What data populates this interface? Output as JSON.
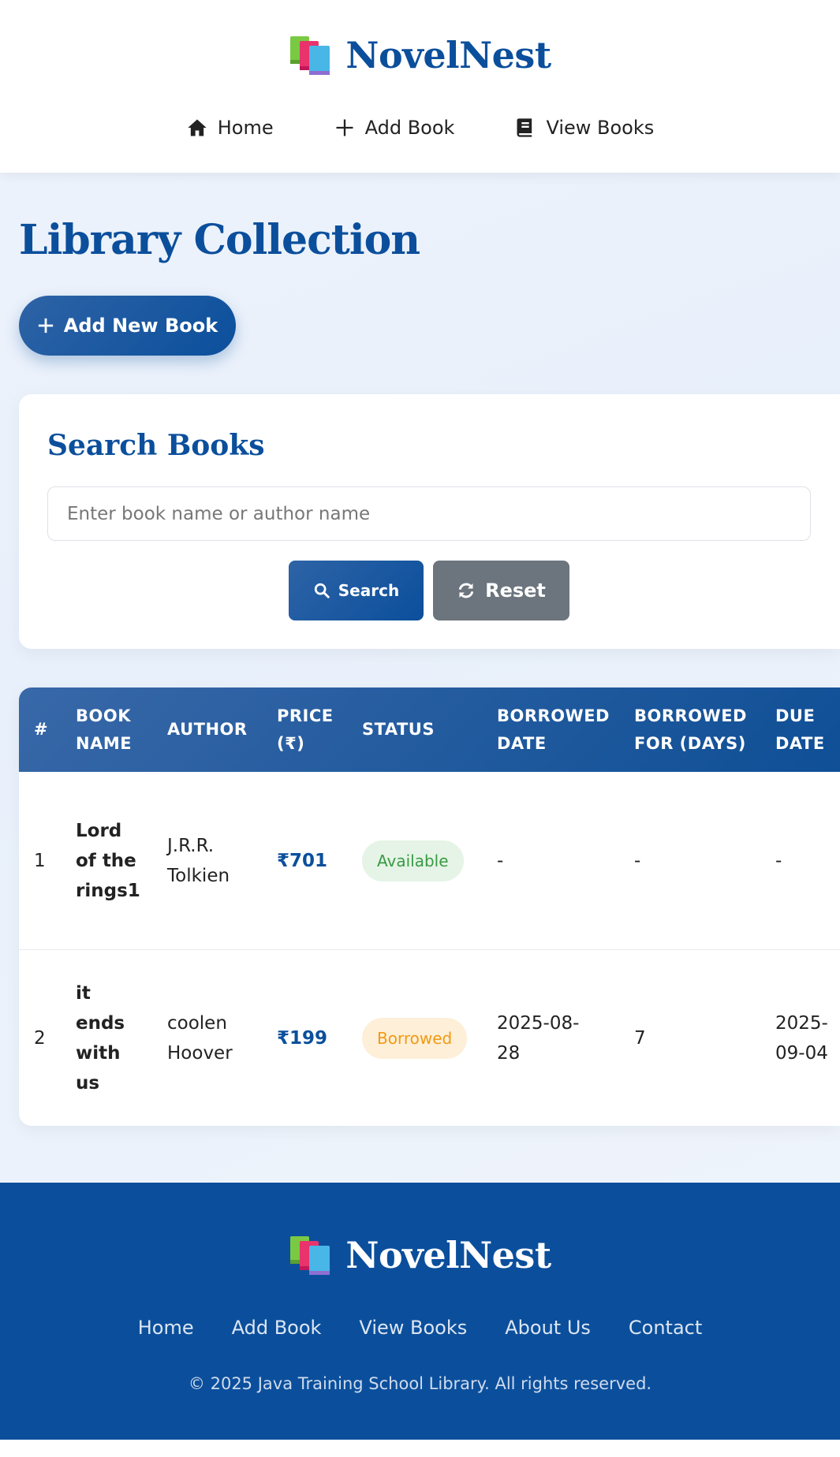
{
  "brand": {
    "name": "NovelNest"
  },
  "nav": [
    {
      "label": "Home",
      "icon": "home-icon"
    },
    {
      "label": "Add Book",
      "icon": "plus-icon"
    },
    {
      "label": "View Books",
      "icon": "book-icon"
    }
  ],
  "page": {
    "title": "Library Collection",
    "add_button_label": "Add New Book"
  },
  "search": {
    "title": "Search Books",
    "placeholder": "Enter book name or author name",
    "value": "",
    "search_button_label": "Search",
    "reset_button_label": "Reset"
  },
  "table": {
    "headers": {
      "index": "#",
      "book_name": [
        "BOOK",
        "NAME"
      ],
      "author": "AUTHOR",
      "price": [
        "PRICE",
        "(₹)"
      ],
      "status": "STATUS",
      "borrowed_date": [
        "BORROWED",
        "DATE"
      ],
      "borrowed_for": [
        "BORROWED",
        "FOR (DAYS)"
      ],
      "due_date": [
        "DUE",
        "DATE"
      ]
    },
    "rows": [
      {
        "index": "1",
        "book_name": [
          "Lord",
          "of the",
          "rings1"
        ],
        "author": [
          "J.R.R.",
          "Tolkien"
        ],
        "price": "₹701",
        "status": "Available",
        "borrowed_date": [
          "-"
        ],
        "borrowed_for": "-",
        "due_date": [
          "-"
        ]
      },
      {
        "index": "2",
        "book_name": [
          "it",
          "ends",
          "with",
          "us"
        ],
        "author": [
          "coolen",
          "Hoover"
        ],
        "price": "₹199",
        "status": "Borrowed",
        "borrowed_date": [
          "2025-08-",
          "28"
        ],
        "borrowed_for": "7",
        "due_date": [
          "2025-",
          "09-04"
        ]
      }
    ]
  },
  "footer": {
    "brand": "NovelNest",
    "links": [
      "Home",
      "Add Book",
      "View Books",
      "About Us",
      "Contact"
    ],
    "copyright": "© 2025 Java Training School Library. All rights reserved."
  },
  "colors": {
    "primary": "#0b4f9c",
    "available_text": "#3a9a45",
    "available_bg": "#e5f4e6",
    "borrowed_text": "#f19a12",
    "borrowed_bg": "#fdefd8",
    "reset_button": "#6c757d"
  }
}
